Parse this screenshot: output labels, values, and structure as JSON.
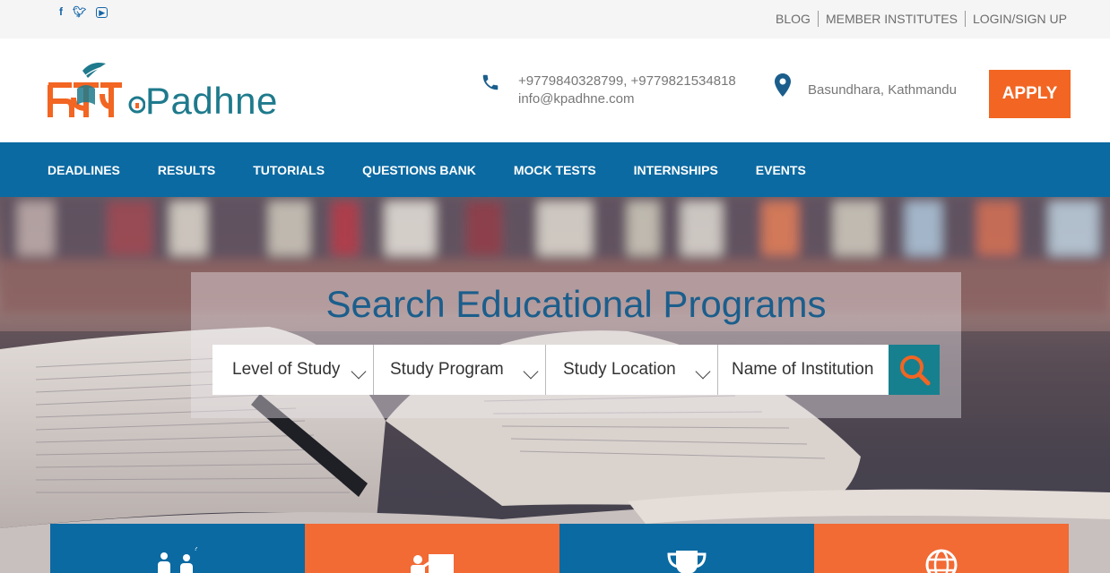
{
  "topbar": {
    "social": [
      {
        "icon": "facebook-icon",
        "glyph": "f"
      },
      {
        "icon": "twitter-icon",
        "glyph": "t"
      },
      {
        "icon": "youtube-icon",
        "glyph": "▶"
      }
    ],
    "links": [
      "BLOG",
      "MEMBER INSTITUTES",
      "LOGIN/SIGN UP"
    ]
  },
  "header": {
    "logo_text": "Padhne",
    "phones": "+9779840328799, +9779821534818",
    "email": "info@kpadhne.com",
    "location": "Basundhara, Kathmandu",
    "apply_label": "APPLY"
  },
  "nav": {
    "items": [
      "DEADLINES",
      "RESULTS",
      "TUTORIALS",
      "QUESTIONS BANK",
      "MOCK TESTS",
      "INTERNSHIPS",
      "EVENTS"
    ]
  },
  "search": {
    "title": "Search Educational Programs",
    "level_label": "Level of Study",
    "program_label": "Study Program",
    "location_label": "Study Location",
    "institution_placeholder": "Name of Institution"
  },
  "cards": [
    {
      "icon": "students-question-icon"
    },
    {
      "icon": "teacher-board-icon"
    },
    {
      "icon": "trophy-icon"
    },
    {
      "icon": "globe-icon"
    }
  ],
  "colors": {
    "brand_blue": "#0b6aa2",
    "brand_orange": "#f26522",
    "teal": "#16808f"
  }
}
